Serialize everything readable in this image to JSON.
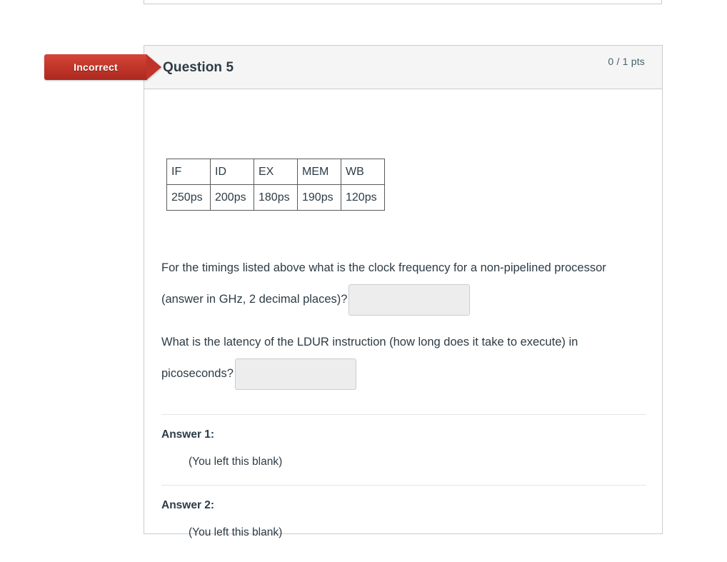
{
  "question": {
    "status_label": "Incorrect",
    "title": "Question 5",
    "points": "0 / 1 pts",
    "timing_table": {
      "headers": [
        "IF",
        "ID",
        "EX",
        "MEM",
        "WB"
      ],
      "values": [
        "250ps",
        "200ps",
        "180ps",
        "190ps",
        "120ps"
      ]
    },
    "prompts": [
      {
        "text_before": "For the timings listed above what is the clock frequency for a non-pipelined processor (answer in GHz, 2 decimal places)?",
        "input_value": "",
        "input_placeholder": ""
      },
      {
        "text_before": "What is the latency of the LDUR instruction (how long does it take to execute) in picoseconds?",
        "input_value": "",
        "input_placeholder": ""
      }
    ],
    "answers": [
      {
        "label": "Answer 1:",
        "value": "(You left this blank)"
      },
      {
        "label": "Answer 2:",
        "value": "(You left this blank)"
      }
    ]
  },
  "colors": {
    "status_red": "#c3362b",
    "header_bg": "#f5f5f5",
    "border": "#c7cdd1",
    "text": "#2d3b45",
    "points_text": "#45616e",
    "input_bg": "#ededed"
  }
}
